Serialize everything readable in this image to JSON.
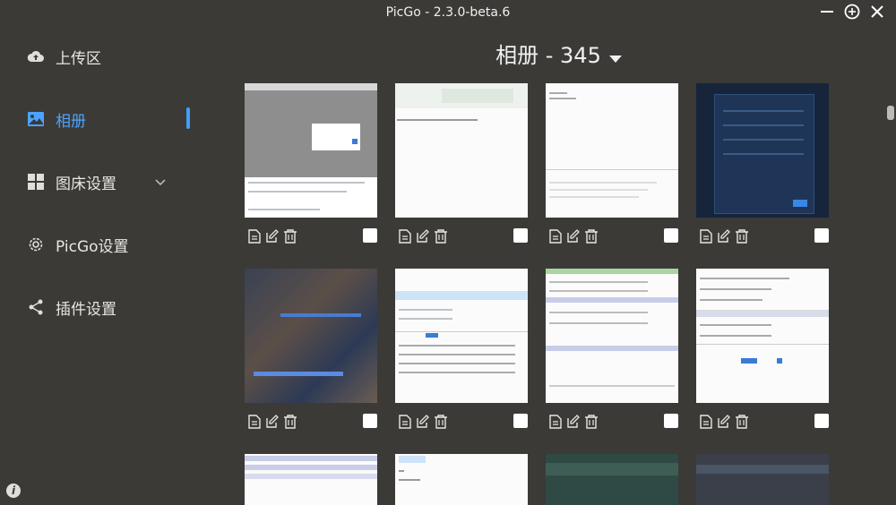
{
  "window": {
    "title": "PicGo - 2.3.0-beta.6"
  },
  "sidebar": {
    "items": [
      {
        "label": "上传区",
        "icon": "cloud-upload-icon"
      },
      {
        "label": "相册",
        "icon": "image-icon",
        "active": true
      },
      {
        "label": "图床设置",
        "icon": "grid-icon"
      },
      {
        "label": "PicGo设置",
        "icon": "gear-icon"
      },
      {
        "label": "插件设置",
        "icon": "share-icon"
      }
    ]
  },
  "main": {
    "album_title": "相册 - 345"
  },
  "colors": {
    "accent": "#409eff",
    "background": "#3b3a37"
  }
}
